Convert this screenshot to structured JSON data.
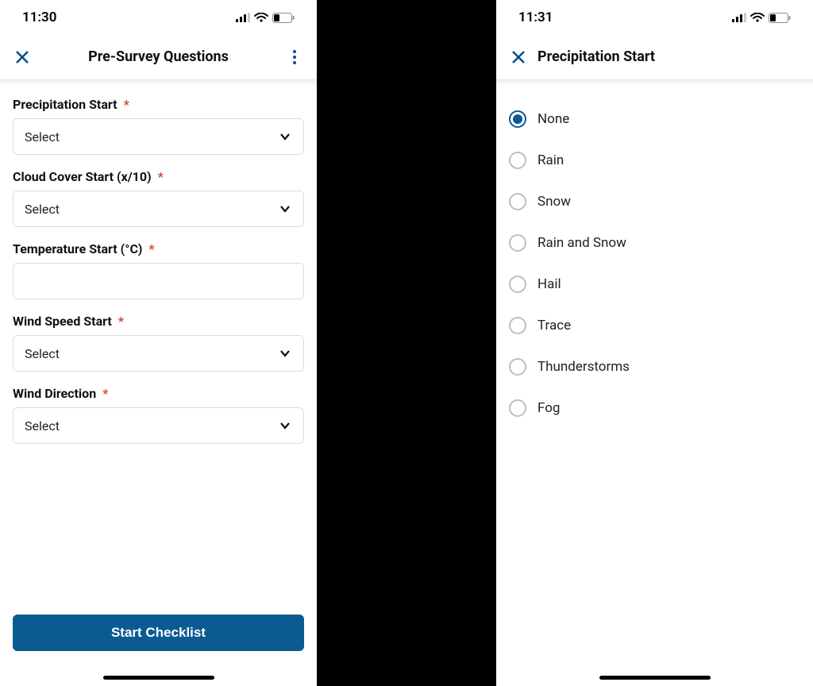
{
  "status": {
    "left_time": "11:30",
    "right_time": "11:31",
    "battery": "32"
  },
  "colors": {
    "accent": "#0b5b93",
    "required": "#d6422f"
  },
  "leftScreen": {
    "title": "Pre-Survey Questions",
    "select_placeholder": "Select",
    "required_mark": "*",
    "fields": [
      {
        "label": "Precipitation Start",
        "type": "select",
        "value": "Select"
      },
      {
        "label": "Cloud Cover Start (x/10)",
        "type": "select",
        "value": "Select"
      },
      {
        "label": "Temperature Start (°C)",
        "type": "text",
        "value": ""
      },
      {
        "label": "Wind Speed Start",
        "type": "select",
        "value": "Select"
      },
      {
        "label": "Wind Direction",
        "type": "select",
        "value": "Select"
      }
    ],
    "primary_button": "Start Checklist"
  },
  "rightScreen": {
    "title": "Precipitation Start",
    "selected_index": 0,
    "options": [
      "None",
      "Rain",
      "Snow",
      "Rain and Snow",
      "Hail",
      "Trace",
      "Thunderstorms",
      "Fog"
    ]
  }
}
